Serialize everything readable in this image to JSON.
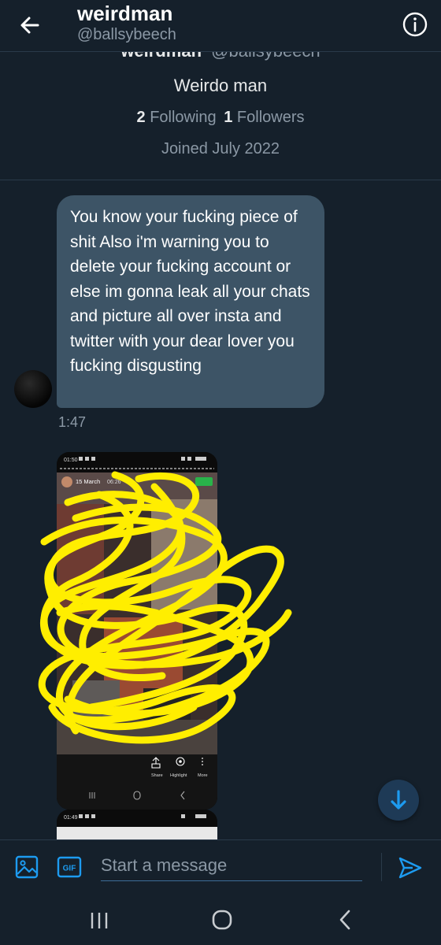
{
  "header": {
    "name": "weirdman",
    "handle": "@ballsybeech"
  },
  "profile": {
    "cut_name": "weirdman",
    "cut_handle": "@ballsybeech",
    "bio": "Weirdo man",
    "following_count": "2",
    "following_label": "Following",
    "followers_count": "1",
    "followers_label": "Followers",
    "joined": "Joined July 2022"
  },
  "messages": [
    {
      "text": "You know your fucking piece of shit Also i'm warning you to delete your fucking account or  else im gonna leak all your chats and picture all over insta and twitter with your dear lover you fucking disgusting",
      "time": "1:47"
    }
  ],
  "attachment1": {
    "status_time": "01:50",
    "date": "15 March",
    "time": "06:26",
    "share": "Share",
    "highlight": "Highlight",
    "more": "More"
  },
  "attachment2": {
    "status_time": "01:49"
  },
  "composer": {
    "gif_label": "GIF",
    "placeholder": "Start a message"
  },
  "colors": {
    "background": "#15202b",
    "bubble": "#3d5466",
    "accent": "#1d9bf0",
    "scribble": "#ffee00"
  },
  "icons": {
    "back": "arrow-left",
    "info": "info-circle",
    "image": "image",
    "gif": "gif",
    "send": "send",
    "scroll_down": "arrow-down"
  }
}
